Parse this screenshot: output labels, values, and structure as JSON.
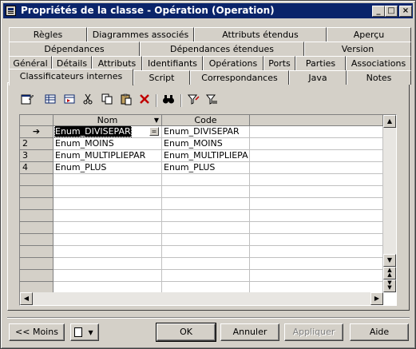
{
  "window": {
    "title": "Propriétés de la classe - Opération (Operation)",
    "minimize_glyph": "_",
    "maximize_glyph": "□",
    "close_glyph": "×"
  },
  "tabs": {
    "row1": [
      "Règles",
      "Diagrammes associés",
      "Attributs étendus",
      "Aperçu"
    ],
    "row2": [
      "Dépendances",
      "Dépendances étendues",
      "Version"
    ],
    "row3": [
      "Général",
      "Détails",
      "Attributs",
      "Identifiants",
      "Opérations",
      "Ports",
      "Parties",
      "Associations"
    ],
    "row4": [
      "Classificateurs internes",
      "Script",
      "Correspondances",
      "Java",
      "Notes"
    ],
    "active": "Classificateurs internes"
  },
  "toolbar": {
    "icons": [
      "properties-icon",
      "add-row-icon",
      "insert-row-icon",
      "cut-icon",
      "copy-icon",
      "paste-icon",
      "delete-icon",
      "find-icon",
      "filter-icon",
      "clear-filter-icon"
    ]
  },
  "grid": {
    "columns": [
      "Nom",
      "Code"
    ],
    "rows": [
      {
        "marker": "➔",
        "nom": "Enum_DIVISEPAR",
        "code": "Enum_DIVISEPAR"
      },
      {
        "marker": "2",
        "nom": "Enum_MOINS",
        "code": "Enum_MOINS"
      },
      {
        "marker": "3",
        "nom": "Enum_MULTIPLIEPAR",
        "code": "Enum_MULTIPLIEPA"
      },
      {
        "marker": "4",
        "nom": "Enum_PLUS",
        "code": "Enum_PLUS"
      }
    ],
    "cell_button_glyph": "="
  },
  "buttons": {
    "less": "<< Moins",
    "ok": "OK",
    "cancel": "Annuler",
    "apply": "Appliquer",
    "help": "Aide"
  }
}
